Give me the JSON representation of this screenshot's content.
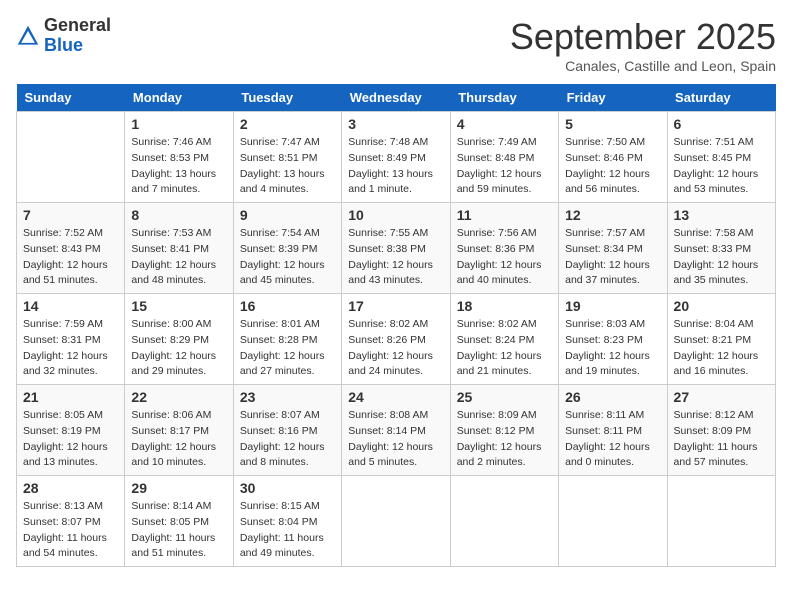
{
  "logo": {
    "general": "General",
    "blue": "Blue"
  },
  "title": "September 2025",
  "subtitle": "Canales, Castille and Leon, Spain",
  "days_of_week": [
    "Sunday",
    "Monday",
    "Tuesday",
    "Wednesday",
    "Thursday",
    "Friday",
    "Saturday"
  ],
  "weeks": [
    [
      {
        "day": "",
        "info": ""
      },
      {
        "day": "1",
        "info": "Sunrise: 7:46 AM\nSunset: 8:53 PM\nDaylight: 13 hours\nand 7 minutes."
      },
      {
        "day": "2",
        "info": "Sunrise: 7:47 AM\nSunset: 8:51 PM\nDaylight: 13 hours\nand 4 minutes."
      },
      {
        "day": "3",
        "info": "Sunrise: 7:48 AM\nSunset: 8:49 PM\nDaylight: 13 hours\nand 1 minute."
      },
      {
        "day": "4",
        "info": "Sunrise: 7:49 AM\nSunset: 8:48 PM\nDaylight: 12 hours\nand 59 minutes."
      },
      {
        "day": "5",
        "info": "Sunrise: 7:50 AM\nSunset: 8:46 PM\nDaylight: 12 hours\nand 56 minutes."
      },
      {
        "day": "6",
        "info": "Sunrise: 7:51 AM\nSunset: 8:45 PM\nDaylight: 12 hours\nand 53 minutes."
      }
    ],
    [
      {
        "day": "7",
        "info": "Sunrise: 7:52 AM\nSunset: 8:43 PM\nDaylight: 12 hours\nand 51 minutes."
      },
      {
        "day": "8",
        "info": "Sunrise: 7:53 AM\nSunset: 8:41 PM\nDaylight: 12 hours\nand 48 minutes."
      },
      {
        "day": "9",
        "info": "Sunrise: 7:54 AM\nSunset: 8:39 PM\nDaylight: 12 hours\nand 45 minutes."
      },
      {
        "day": "10",
        "info": "Sunrise: 7:55 AM\nSunset: 8:38 PM\nDaylight: 12 hours\nand 43 minutes."
      },
      {
        "day": "11",
        "info": "Sunrise: 7:56 AM\nSunset: 8:36 PM\nDaylight: 12 hours\nand 40 minutes."
      },
      {
        "day": "12",
        "info": "Sunrise: 7:57 AM\nSunset: 8:34 PM\nDaylight: 12 hours\nand 37 minutes."
      },
      {
        "day": "13",
        "info": "Sunrise: 7:58 AM\nSunset: 8:33 PM\nDaylight: 12 hours\nand 35 minutes."
      }
    ],
    [
      {
        "day": "14",
        "info": "Sunrise: 7:59 AM\nSunset: 8:31 PM\nDaylight: 12 hours\nand 32 minutes."
      },
      {
        "day": "15",
        "info": "Sunrise: 8:00 AM\nSunset: 8:29 PM\nDaylight: 12 hours\nand 29 minutes."
      },
      {
        "day": "16",
        "info": "Sunrise: 8:01 AM\nSunset: 8:28 PM\nDaylight: 12 hours\nand 27 minutes."
      },
      {
        "day": "17",
        "info": "Sunrise: 8:02 AM\nSunset: 8:26 PM\nDaylight: 12 hours\nand 24 minutes."
      },
      {
        "day": "18",
        "info": "Sunrise: 8:02 AM\nSunset: 8:24 PM\nDaylight: 12 hours\nand 21 minutes."
      },
      {
        "day": "19",
        "info": "Sunrise: 8:03 AM\nSunset: 8:23 PM\nDaylight: 12 hours\nand 19 minutes."
      },
      {
        "day": "20",
        "info": "Sunrise: 8:04 AM\nSunset: 8:21 PM\nDaylight: 12 hours\nand 16 minutes."
      }
    ],
    [
      {
        "day": "21",
        "info": "Sunrise: 8:05 AM\nSunset: 8:19 PM\nDaylight: 12 hours\nand 13 minutes."
      },
      {
        "day": "22",
        "info": "Sunrise: 8:06 AM\nSunset: 8:17 PM\nDaylight: 12 hours\nand 10 minutes."
      },
      {
        "day": "23",
        "info": "Sunrise: 8:07 AM\nSunset: 8:16 PM\nDaylight: 12 hours\nand 8 minutes."
      },
      {
        "day": "24",
        "info": "Sunrise: 8:08 AM\nSunset: 8:14 PM\nDaylight: 12 hours\nand 5 minutes."
      },
      {
        "day": "25",
        "info": "Sunrise: 8:09 AM\nSunset: 8:12 PM\nDaylight: 12 hours\nand 2 minutes."
      },
      {
        "day": "26",
        "info": "Sunrise: 8:11 AM\nSunset: 8:11 PM\nDaylight: 12 hours\nand 0 minutes."
      },
      {
        "day": "27",
        "info": "Sunrise: 8:12 AM\nSunset: 8:09 PM\nDaylight: 11 hours\nand 57 minutes."
      }
    ],
    [
      {
        "day": "28",
        "info": "Sunrise: 8:13 AM\nSunset: 8:07 PM\nDaylight: 11 hours\nand 54 minutes."
      },
      {
        "day": "29",
        "info": "Sunrise: 8:14 AM\nSunset: 8:05 PM\nDaylight: 11 hours\nand 51 minutes."
      },
      {
        "day": "30",
        "info": "Sunrise: 8:15 AM\nSunset: 8:04 PM\nDaylight: 11 hours\nand 49 minutes."
      },
      {
        "day": "",
        "info": ""
      },
      {
        "day": "",
        "info": ""
      },
      {
        "day": "",
        "info": ""
      },
      {
        "day": "",
        "info": ""
      }
    ]
  ]
}
